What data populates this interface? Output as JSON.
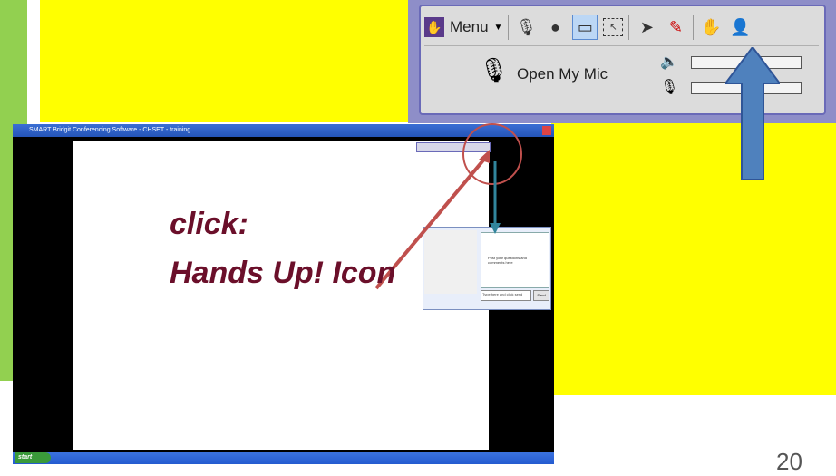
{
  "toolbar": {
    "menu_label": "Menu",
    "open_mic_label": "Open My Mic",
    "icons": [
      "app-icon",
      "mic-dropdown-icon",
      "webcam-icon",
      "screen-share-icon",
      "selection-icon",
      "pointer-icon",
      "pen-icon",
      "hands-up-icon",
      "participants-icon"
    ]
  },
  "screen": {
    "window_title": "SMART Bridgit Conferencing Software - CHSET - training",
    "start_label": "start",
    "chat_prompt": "Post your questions and comments here",
    "chat_input_placeholder": "Type here and click send",
    "send_label": "Send"
  },
  "annotation": {
    "line1": "click:",
    "line2": "Hands Up! Icon"
  },
  "page_number": "20",
  "colors": {
    "green": "#92d050",
    "yellow": "#ffff00",
    "annotation_text": "#6b0f2a",
    "blue_arrow": "#4f81bd",
    "red_arrow": "#c0504d",
    "teal_arrow": "#31859c"
  }
}
